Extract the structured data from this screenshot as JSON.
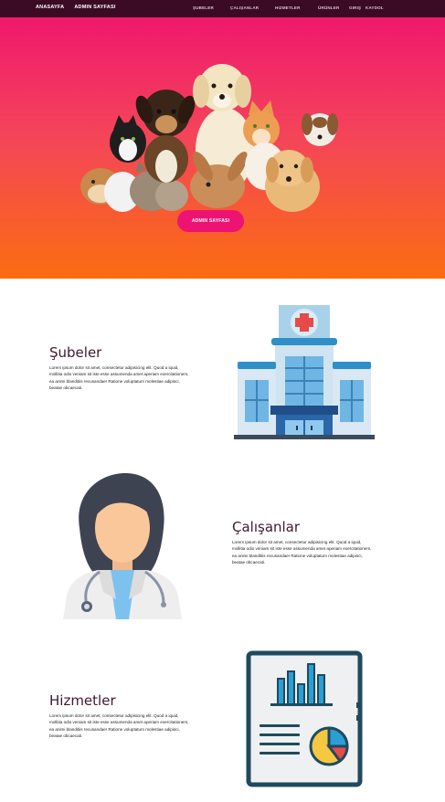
{
  "nav": {
    "brand": [
      "ANASAYFA",
      "ADMIN SAYFASI"
    ],
    "items": [
      "ŞUBELER",
      "ÇALIŞANLAR",
      "HIZMETLER",
      "ÜRÜNLER",
      "GIRIŞ",
      "KAYDOL"
    ]
  },
  "hero": {
    "button_label": "ADMIN SAYFASI"
  },
  "sections": [
    {
      "title": "Şubeler",
      "text": "Lorem ipsum dolor sit amet, consectetur adipisicing elit. Quod a iquid, mollitia odio veniam sit iste esse assumenda amet aperiam exercitationem, ea animi blanditiis recusandae! Ratione voluptatum molestiae adipisci, beatae obcaecati.",
      "icon": "hospital-icon"
    },
    {
      "title": "Çalışanlar",
      "text": "Lorem ipsum dolor sit amet, consectetur adipisicing elit. Quod a iquid, mollitia odio veniam sit iste esse assumenda amet aperiam exercitationem, ea animi blanditiis recusandae! Ratione voluptatum molestiae adipisci, beatae obcaecati.",
      "icon": "doctor-icon"
    },
    {
      "title": "Hizmetler",
      "text": "Lorem ipsum dolor sit amet, consectetur adipisicing elit. Quod a iquid, mollitia odio veniam sit iste esse assumenda amet aperiam exercitationem, ea animi blanditiis recusandae! Ratione voluptatum molestiae adipisci, beatae obcaecati.",
      "icon": "report-icon"
    }
  ],
  "colors": {
    "navbar": "#3b0a25",
    "hero_top": "#f0186d",
    "hero_bottom": "#fb6d10",
    "button": "#ee1273"
  }
}
